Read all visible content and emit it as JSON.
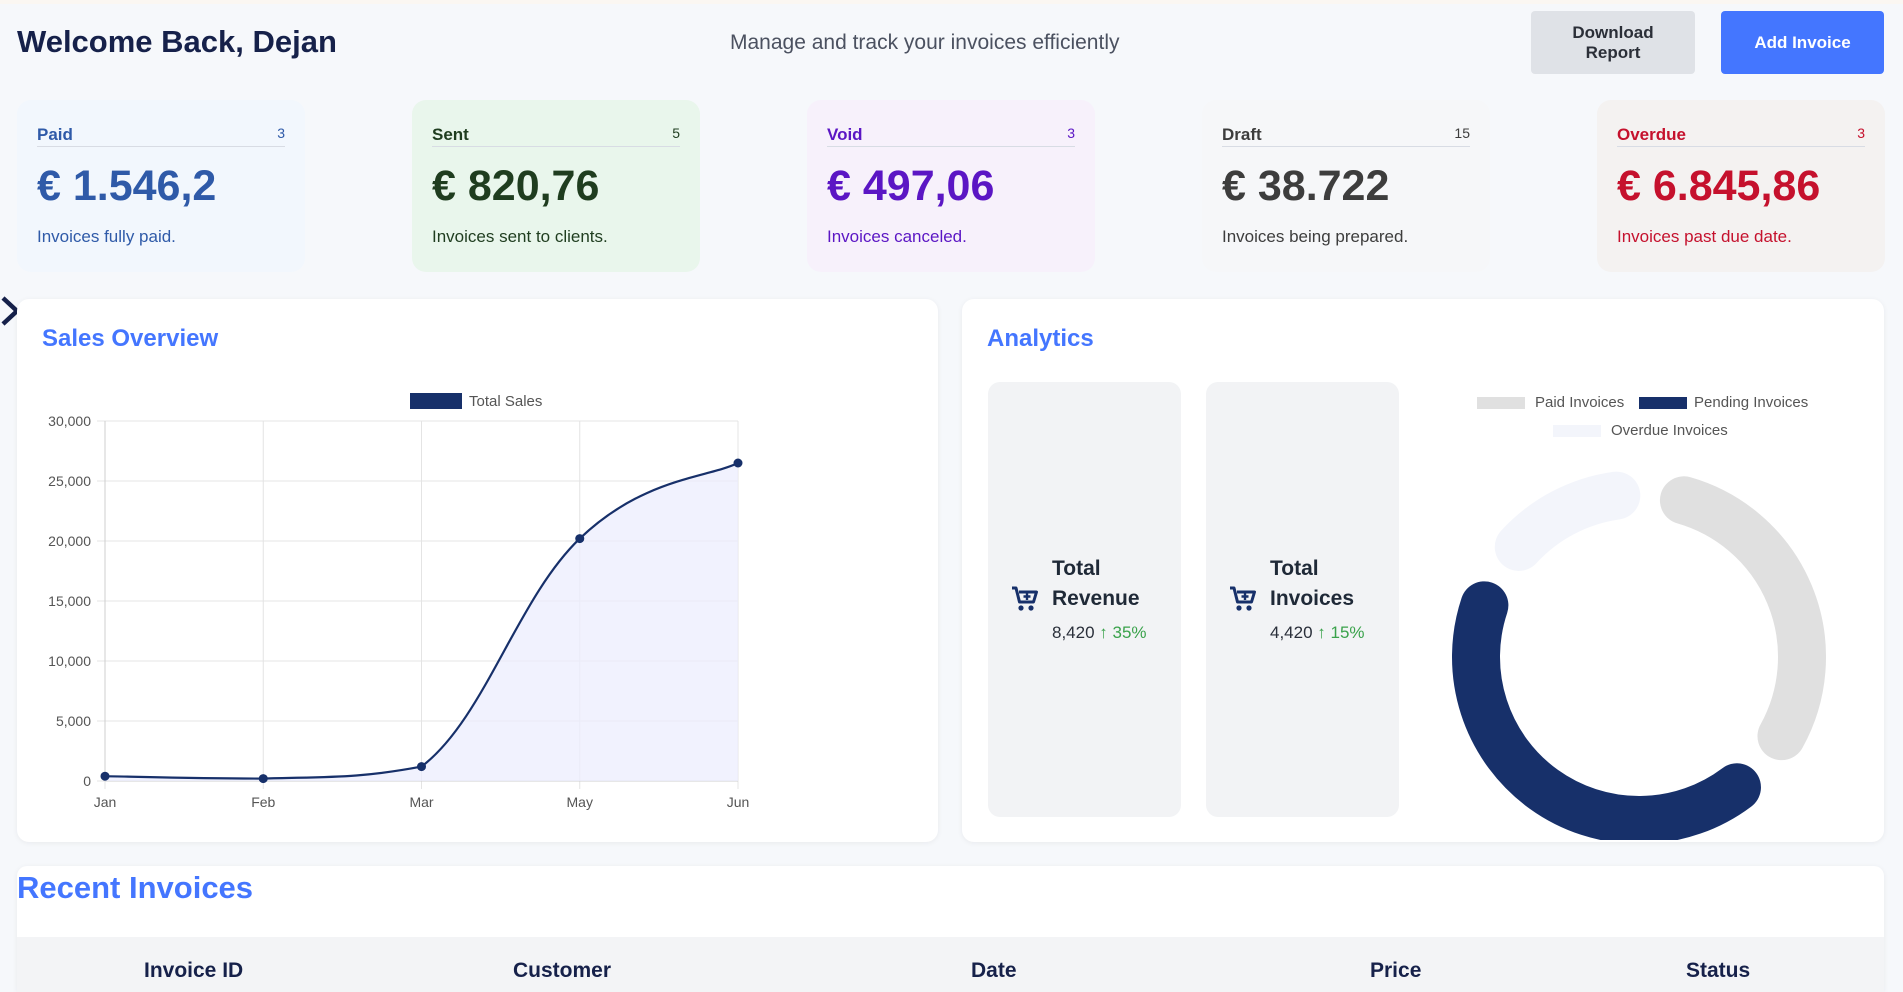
{
  "header": {
    "welcome": "Welcome Back, Dejan",
    "subtitle": "Manage and track your invoices efficiently",
    "download_label": "Download Report",
    "add_label": "Add Invoice"
  },
  "stats": [
    {
      "name": "Paid",
      "count": "3",
      "amount": "€ 1.546,2",
      "desc": "Invoices fully paid.",
      "color": "#2f5aa8",
      "bg": "#f2f7fd"
    },
    {
      "name": "Sent",
      "count": "5",
      "amount": "€ 820,76",
      "desc": "Invoices sent to clients.",
      "color": "#1f3d1f",
      "bg": "#e9f6ec"
    },
    {
      "name": "Void",
      "count": "3",
      "amount": "€ 497,06",
      "desc": "Invoices canceled.",
      "color": "#5b16c4",
      "bg": "#f7f1fb"
    },
    {
      "name": "Draft",
      "count": "15",
      "amount": "€ 38.722",
      "desc": "Invoices being prepared.",
      "color": "#3d3d3d",
      "bg": "#f6f7f9"
    },
    {
      "name": "Overdue",
      "count": "3",
      "amount": "€ 6.845,86",
      "desc": "Invoices past due date.",
      "color": "#c5112d",
      "bg": "#f4f2f1"
    }
  ],
  "sales_overview": {
    "title": "Sales Overview"
  },
  "chart_data": [
    {
      "type": "line",
      "x": [
        "Jan",
        "Feb",
        "Mar",
        "May",
        "Jun"
      ],
      "series": [
        {
          "name": "Total Sales",
          "values": [
            400,
            200,
            1200,
            20200,
            26500
          ]
        }
      ],
      "ylim": [
        0,
        30000
      ],
      "yticks": [
        "0",
        "5,000",
        "10,000",
        "15,000",
        "20,000",
        "25,000",
        "30,000"
      ],
      "grid": true,
      "legend": "top-center",
      "line_color": "#17306a",
      "fill_color": "#eceefd"
    },
    {
      "type": "pie",
      "categories": [
        "Paid Invoices",
        "Pending Invoices",
        "Overdue Invoices"
      ],
      "values": [
        30,
        40,
        15
      ],
      "colors": [
        "#e0e0e0",
        "#17306a",
        "#f3f5fb"
      ],
      "legend": "top"
    }
  ],
  "analytics": {
    "title": "Analytics",
    "metrics": [
      {
        "label_line1": "Total",
        "label_line2": "Revenue",
        "value": "8,420",
        "trend": "↑ 35%",
        "icon": "cart-icon"
      },
      {
        "label_line1": "Total",
        "label_line2": "Invoices",
        "value": "4,420",
        "trend": "↑ 15%",
        "icon": "cart-icon"
      }
    ]
  },
  "recent": {
    "title": "Recent Invoices",
    "columns": [
      "Invoice ID",
      "Customer",
      "Date",
      "Price",
      "Status"
    ]
  }
}
